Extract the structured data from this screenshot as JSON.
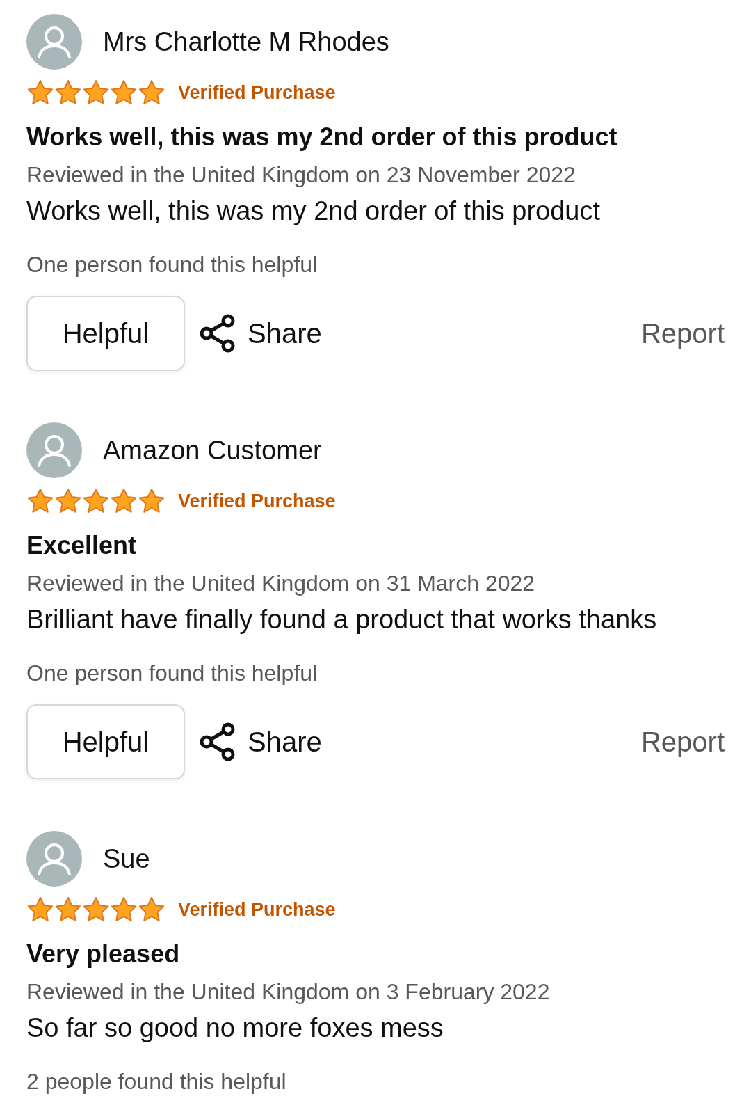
{
  "reviews": [
    {
      "author": "Mrs Charlotte M Rhodes",
      "stars": 5,
      "badge": "Verified Purchase",
      "title": "Works well, this was my 2nd order of this product",
      "date": "Reviewed in the United Kingdom on 23 November 2022",
      "body": "Works well, this was my 2nd order of this product",
      "helpful_count": "One person found this helpful",
      "actions": {
        "helpful": "Helpful",
        "share": "Share",
        "report": "Report"
      }
    },
    {
      "author": "Amazon Customer",
      "stars": 5,
      "badge": "Verified Purchase",
      "title": "Excellent",
      "date": "Reviewed in the United Kingdom on 31 March 2022",
      "body": "Brilliant have finally found a product that works thanks",
      "helpful_count": "One person found this helpful",
      "actions": {
        "helpful": "Helpful",
        "share": "Share",
        "report": "Report"
      }
    },
    {
      "author": "Sue",
      "stars": 5,
      "badge": "Verified Purchase",
      "title": "Very pleased",
      "date": "Reviewed in the United Kingdom on 3 February 2022",
      "body": "So far so good no more foxes mess",
      "helpful_count": "2 people found this helpful"
    }
  ]
}
